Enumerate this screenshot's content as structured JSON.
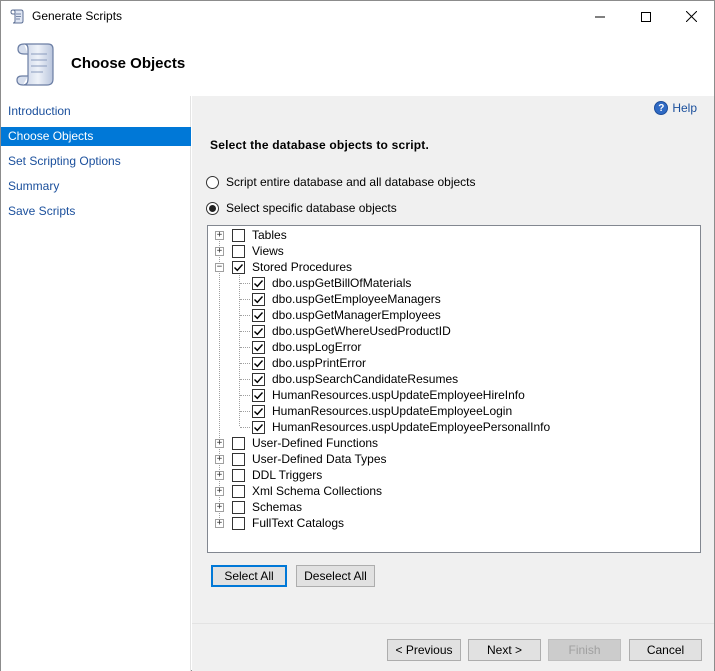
{
  "window": {
    "title": "Generate Scripts"
  },
  "header": {
    "title": "Choose Objects"
  },
  "sidebar": {
    "items": [
      {
        "label": "Introduction",
        "active": false
      },
      {
        "label": "Choose Objects",
        "active": true
      },
      {
        "label": "Set Scripting Options",
        "active": false
      },
      {
        "label": "Summary",
        "active": false
      },
      {
        "label": "Save Scripts",
        "active": false
      }
    ]
  },
  "main": {
    "help_label": "Help",
    "section_title": "Select the database objects to script.",
    "radio_entire": "Script entire database and all database objects",
    "radio_specific": "Select specific database objects",
    "selected_radio": "specific"
  },
  "tree": {
    "top_before": [
      {
        "label": "Tables",
        "checked": false,
        "expanded": false
      },
      {
        "label": "Views",
        "checked": false,
        "expanded": false
      },
      {
        "label": "Stored Procedures",
        "checked": true,
        "expanded": true
      }
    ],
    "procedures": [
      {
        "label": "dbo.uspGetBillOfMaterials",
        "checked": true
      },
      {
        "label": "dbo.uspGetEmployeeManagers",
        "checked": true
      },
      {
        "label": "dbo.uspGetManagerEmployees",
        "checked": true
      },
      {
        "label": "dbo.uspGetWhereUsedProductID",
        "checked": true
      },
      {
        "label": "dbo.uspLogError",
        "checked": true
      },
      {
        "label": "dbo.uspPrintError",
        "checked": true
      },
      {
        "label": "dbo.uspSearchCandidateResumes",
        "checked": true
      },
      {
        "label": "HumanResources.uspUpdateEmployeeHireInfo",
        "checked": true
      },
      {
        "label": "HumanResources.uspUpdateEmployeeLogin",
        "checked": true
      },
      {
        "label": "HumanResources.uspUpdateEmployeePersonalInfo",
        "checked": true
      }
    ],
    "top_after": [
      {
        "label": "User-Defined Functions",
        "checked": false,
        "expanded": false
      },
      {
        "label": "User-Defined Data Types",
        "checked": false,
        "expanded": false
      },
      {
        "label": "DDL Triggers",
        "checked": false,
        "expanded": false
      },
      {
        "label": "Xml Schema Collections",
        "checked": false,
        "expanded": false
      },
      {
        "label": "Schemas",
        "checked": false,
        "expanded": false
      },
      {
        "label": "FullText Catalogs",
        "checked": false,
        "expanded": false
      }
    ]
  },
  "buttons": {
    "select_all": "Select All",
    "deselect_all": "Deselect All",
    "previous": "< Previous",
    "next": "Next >",
    "finish": "Finish",
    "cancel": "Cancel"
  },
  "colors": {
    "accent": "#0078d7",
    "link": "#1a4f9c",
    "panel_bg": "#f0f0f0"
  },
  "icons": {
    "app": "scroll-icon",
    "help": "help-icon",
    "check": "checkmark-icon"
  }
}
